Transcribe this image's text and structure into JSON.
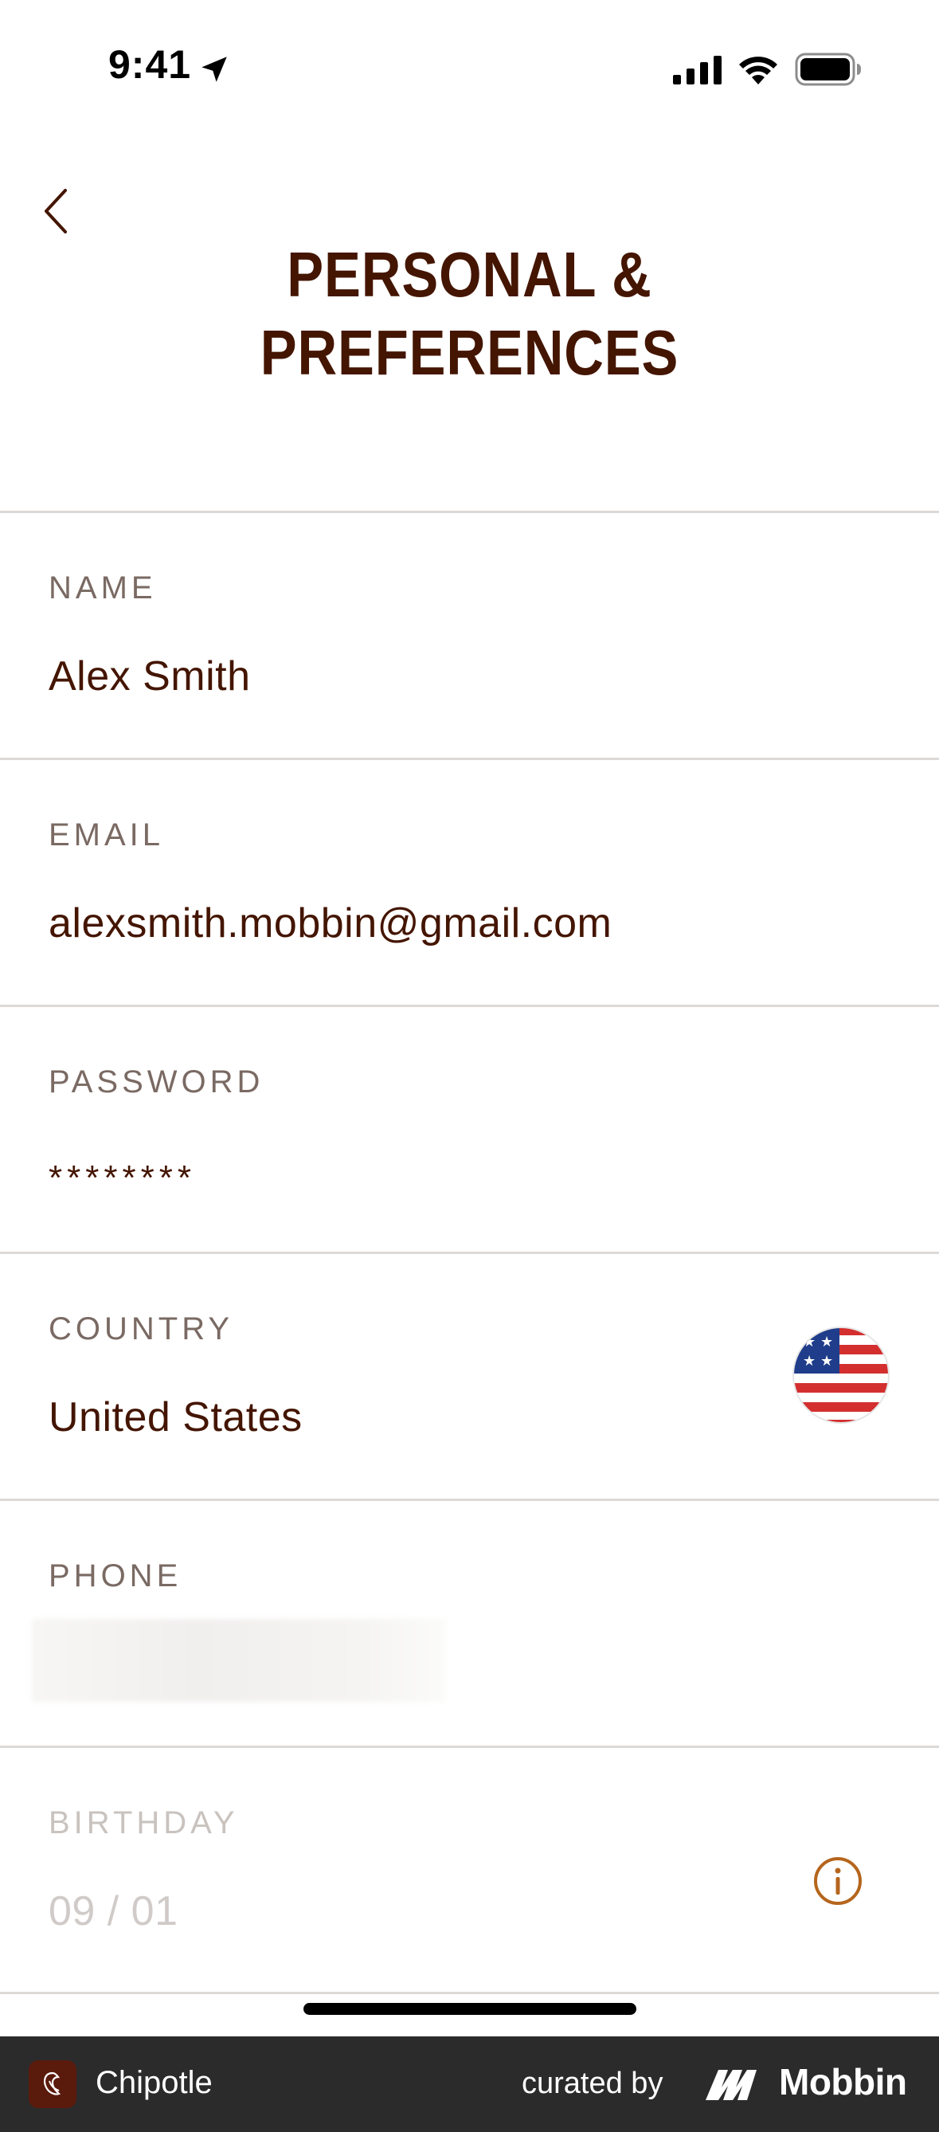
{
  "status_bar": {
    "time": "9:41"
  },
  "header": {
    "title_line1": "PERSONAL &",
    "title_line2": "PREFERENCES"
  },
  "fields": {
    "name": {
      "label": "NAME",
      "value": "Alex Smith"
    },
    "email": {
      "label": "EMAIL",
      "value": "alexsmith.mobbin@gmail.com"
    },
    "password": {
      "label": "PASSWORD",
      "value": "********"
    },
    "country": {
      "label": "COUNTRY",
      "value": "United States"
    },
    "phone": {
      "label": "PHONE"
    },
    "birthday": {
      "label": "BIRTHDAY",
      "value": "09 / 01"
    }
  },
  "footer": {
    "app_name": "Chipotle",
    "curated_by": "curated by",
    "brand": "Mobbin"
  },
  "colors": {
    "brand_brown": "#441500",
    "label_gray": "#7a6a63",
    "divider": "#dcd9d6",
    "info_accent": "#b5651d",
    "footer_bg": "#2b2b2b"
  }
}
